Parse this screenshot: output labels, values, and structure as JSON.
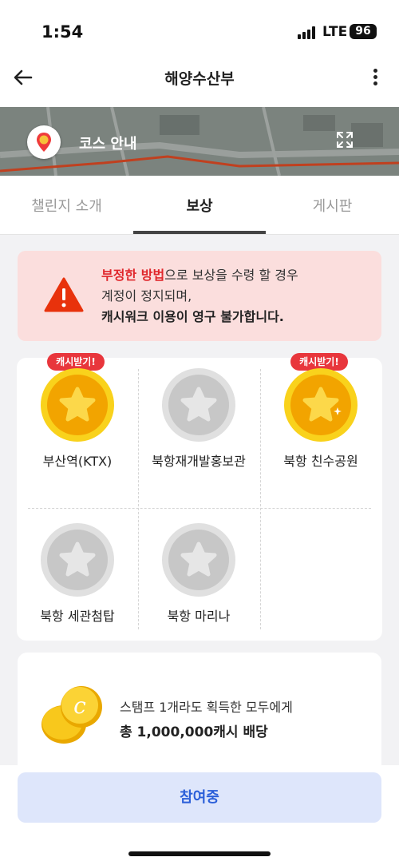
{
  "status_bar": {
    "time": "1:54",
    "network": "LTE",
    "battery": "96"
  },
  "header": {
    "title": "해양수산부",
    "back_icon": "arrow-left-icon",
    "more_icon": "more-vertical-icon"
  },
  "map_banner": {
    "label": "코스 안내",
    "pin_icon": "location-pin-icon",
    "expand_icon": "expand-icon"
  },
  "tabs": [
    {
      "label": "챌린지 소개",
      "active": false
    },
    {
      "label": "보상",
      "active": true
    },
    {
      "label": "게시판",
      "active": false
    }
  ],
  "warning": {
    "icon": "warning-triangle-icon",
    "line1_red": "부정한 방법",
    "line1_rest": "으로 보상을 수령 할 경우",
    "line2": "계정이 정지되며,",
    "line3": "캐시워크 이용이 영구 불가합니다."
  },
  "stamps": [
    {
      "name": "부산역(KTX)",
      "acquired": true,
      "badge": "캐시받기!"
    },
    {
      "name": "북항재개발홍보관",
      "acquired": false,
      "badge": ""
    },
    {
      "name": "북항 친수공원",
      "acquired": true,
      "badge": "캐시받기!"
    },
    {
      "name": "북항 세관첨탑",
      "acquired": false,
      "badge": ""
    },
    {
      "name": "북항 마리나",
      "acquired": false,
      "badge": ""
    }
  ],
  "reward": {
    "icon": "gold-coins-icon",
    "line1": "스탬프 1개라도 획득한 모두에게",
    "line2": "총 1,000,000캐시 배당"
  },
  "join_button": {
    "label": "참여중"
  },
  "colors": {
    "accent_red": "#e8363c",
    "warning_bg": "#fbdedd",
    "button_bg": "#dee6fb",
    "button_text": "#2b5fd9",
    "gold": "#f5b800"
  }
}
